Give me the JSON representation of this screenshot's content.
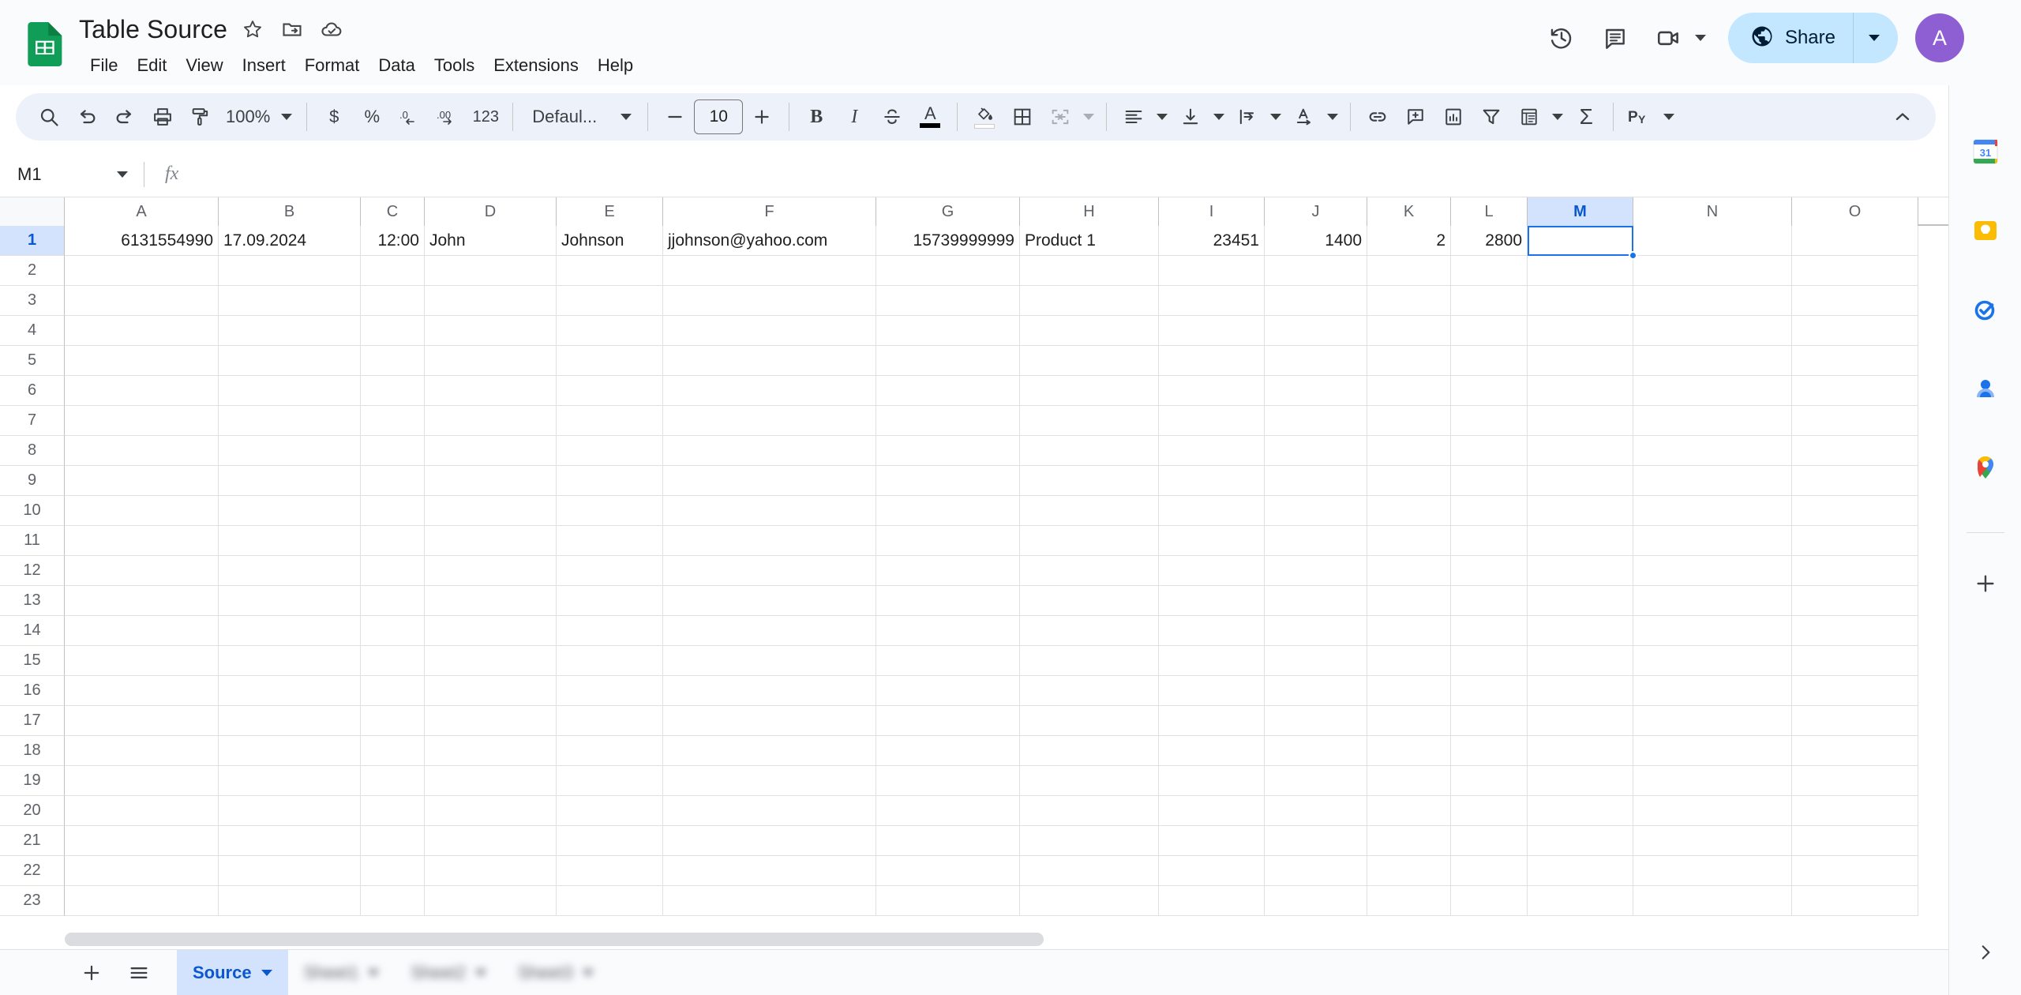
{
  "app": {
    "logo_icon": "sheets-logo-icon",
    "title": "Table Source",
    "title_icons": [
      "star-icon",
      "move-to-folder-icon",
      "cloud-saved-icon"
    ],
    "menus": [
      "File",
      "Edit",
      "View",
      "Insert",
      "Format",
      "Data",
      "Tools",
      "Extensions",
      "Help"
    ]
  },
  "topright": {
    "history_icon": "version-history-icon",
    "comment_icon": "comment-icon",
    "meet_icon": "video-camera-icon",
    "share_icon": "globe-icon",
    "share_label": "Share",
    "avatar_initial": "A",
    "avatar_color": "#8e5fd3",
    "share_bg": "#c2e7ff"
  },
  "toolbar": {
    "zoom_value": "100%",
    "font_name": "Defaul...",
    "font_size": "10",
    "items": [
      "search-icon",
      "undo-icon",
      "redo-icon",
      "print-icon",
      "paint-format-icon",
      "currency-icon",
      "percent-icon",
      "decrease-decimal-icon",
      "increase-decimal-icon",
      "number-format-icon",
      "decrease-font-size-icon",
      "increase-font-size-icon",
      "bold-icon",
      "italic-icon",
      "strikethrough-icon",
      "text-color-icon",
      "fill-color-icon",
      "borders-icon",
      "merge-cells-icon",
      "horizontal-align-icon",
      "vertical-align-icon",
      "text-wrap-icon",
      "text-rotation-icon",
      "insert-link-icon",
      "insert-comment-icon",
      "insert-chart-icon",
      "create-filter-icon",
      "functions-icon",
      "sum-icon",
      "explore-icon",
      "collapse-toolbar-icon"
    ],
    "currency_label": "$",
    "percent_label": "%",
    "decrease_decimal_label": ".0",
    "increase_decimal_label": ".00",
    "number_format_label": "123",
    "bold_label": "B",
    "italic_label": "I",
    "strike_label": "S",
    "text_color_label": "A",
    "sum_label": "Σ",
    "explore_label": "P"
  },
  "formula_bar": {
    "name_box_value": "M1",
    "fx_label": "fx",
    "formula_value": "",
    "formula_placeholder": ""
  },
  "grid": {
    "columns": [
      "A",
      "B",
      "C",
      "D",
      "E",
      "F",
      "G",
      "H",
      "I",
      "J",
      "K",
      "L",
      "M",
      "N",
      "O"
    ],
    "selected_column": "M",
    "selected_row": "1",
    "selected_cell": "M1",
    "rows": [
      "1",
      "2",
      "3",
      "4",
      "5",
      "6",
      "7",
      "8",
      "9",
      "10",
      "11",
      "12",
      "13",
      "14",
      "15",
      "16",
      "17",
      "18",
      "19",
      "20",
      "21",
      "22",
      "23"
    ],
    "data": [
      {
        "col": "A",
        "value": "6131554990",
        "align": "right"
      },
      {
        "col": "B",
        "value": "17.09.2024",
        "align": "left"
      },
      {
        "col": "C",
        "value": "12:00",
        "align": "right"
      },
      {
        "col": "D",
        "value": "John",
        "align": "left"
      },
      {
        "col": "E",
        "value": "Johnson",
        "align": "left"
      },
      {
        "col": "F",
        "value": "jjohnson@yahoo.com",
        "align": "left"
      },
      {
        "col": "G",
        "value": "15739999999",
        "align": "right"
      },
      {
        "col": "H",
        "value": "Product 1",
        "align": "left"
      },
      {
        "col": "I",
        "value": "23451",
        "align": "right"
      },
      {
        "col": "J",
        "value": "1400",
        "align": "right"
      },
      {
        "col": "K",
        "value": "2",
        "align": "right"
      },
      {
        "col": "L",
        "value": "2800",
        "align": "right"
      },
      {
        "col": "M",
        "value": "",
        "align": "left"
      },
      {
        "col": "N",
        "value": "",
        "align": "left"
      },
      {
        "col": "O",
        "value": "",
        "align": "left"
      }
    ],
    "selection_color": "#1a73e8",
    "header_selected_bg": "#d3e3fd"
  },
  "sheet_bar": {
    "add_sheet_icon": "add-sheet-icon",
    "all_sheets_icon": "all-sheets-icon",
    "tabs": [
      {
        "label": "Source",
        "active": true,
        "blurred": false
      },
      {
        "label": "Sheet1",
        "active": false,
        "blurred": true
      },
      {
        "label": "Sheet2",
        "active": false,
        "blurred": true
      },
      {
        "label": "Sheet3",
        "active": false,
        "blurred": true
      }
    ]
  },
  "side_panel": {
    "icons": [
      "google-calendar-icon",
      "google-keep-icon",
      "google-tasks-icon",
      "google-contacts-icon",
      "google-maps-icon"
    ],
    "calendar_day": "31",
    "add_label": "add-apps-icon",
    "expand_icon": "expand-panel-icon"
  }
}
